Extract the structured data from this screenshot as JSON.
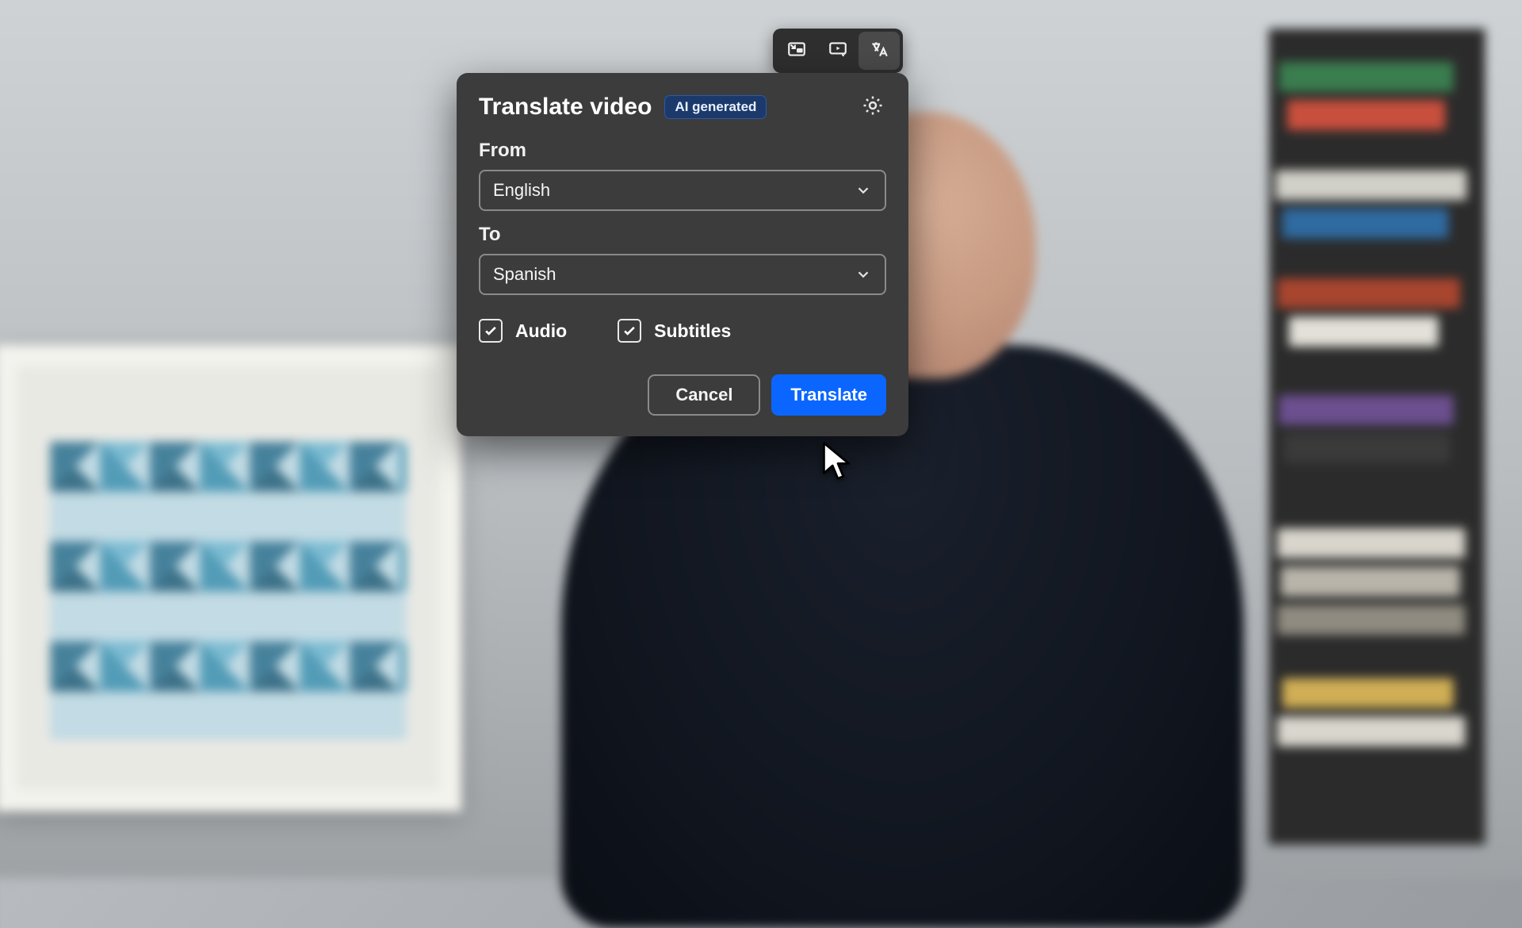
{
  "toolbar": {
    "pip_name": "picture-in-picture-icon",
    "cast_name": "cast-icon",
    "translate_name": "translate-icon"
  },
  "dialog": {
    "title": "Translate video",
    "badge": "AI generated",
    "from_label": "From",
    "from_value": "English",
    "to_label": "To",
    "to_value": "Spanish",
    "audio_label": "Audio",
    "audio_checked": true,
    "subtitles_label": "Subtitles",
    "subtitles_checked": true,
    "cancel_label": "Cancel",
    "translate_label": "Translate"
  },
  "colors": {
    "dialog_bg": "#3c3c3c",
    "primary": "#0a66ff",
    "badge_bg": "#1b3a6b"
  }
}
